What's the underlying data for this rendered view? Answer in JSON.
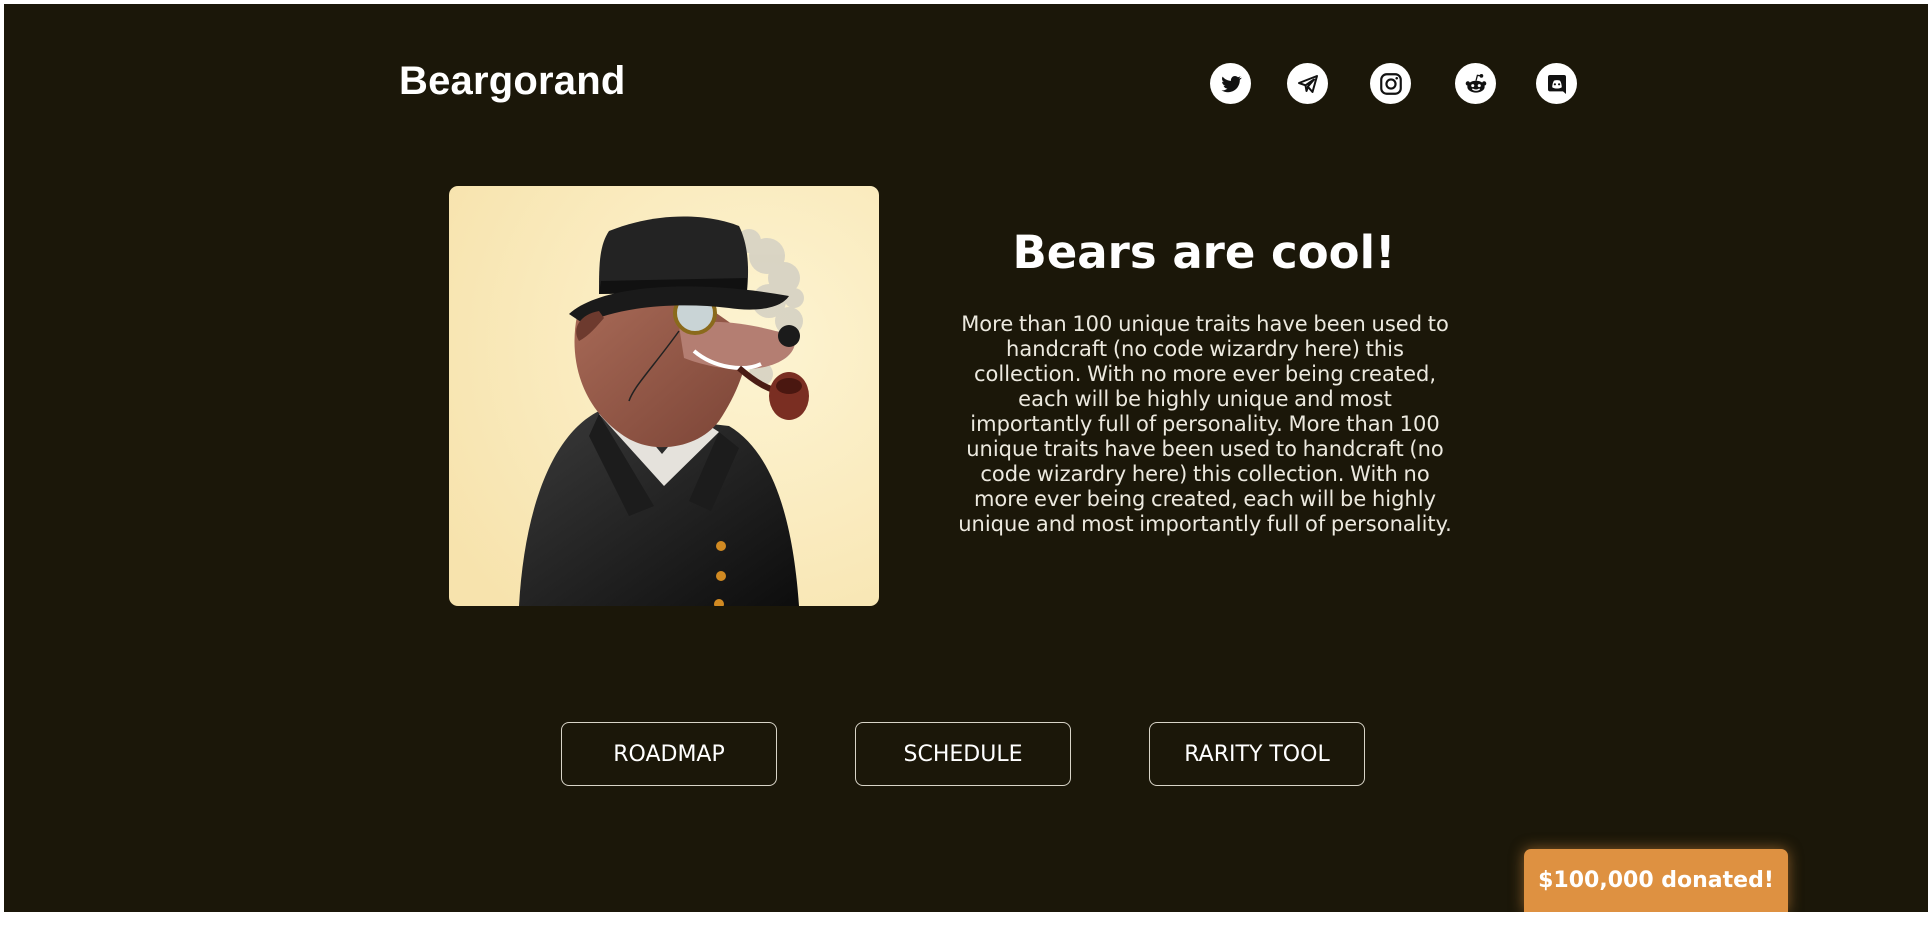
{
  "brand": {
    "name": "Beargorand"
  },
  "socials": [
    {
      "icon": "twitter-icon"
    },
    {
      "icon": "telegram-icon"
    },
    {
      "icon": "instagram-icon"
    },
    {
      "icon": "reddit-icon"
    },
    {
      "icon": "discord-icon"
    }
  ],
  "hero": {
    "headline": "Bears are cool!",
    "description": "More than 100 unique traits have been used to handcraft (no code wizardry here) this collection. With no more ever being created, each will be highly unique and most importantly full of personality. More than 100 unique traits have been used to handcraft (no code wizardry here) this collection. With no more ever being created, each will be highly unique and most importantly full of personality.",
    "image": "bear-in-hat-with-monocle-and-pipe"
  },
  "nav": {
    "roadmap": "ROADMAP",
    "schedule": "SCHEDULE",
    "rarity_tool": "RARITY TOOL"
  },
  "badge": {
    "donated": "$100,000 donated!"
  },
  "colors": {
    "background": "#1b1709",
    "accent": "#de9141",
    "text": "#ffffff"
  }
}
